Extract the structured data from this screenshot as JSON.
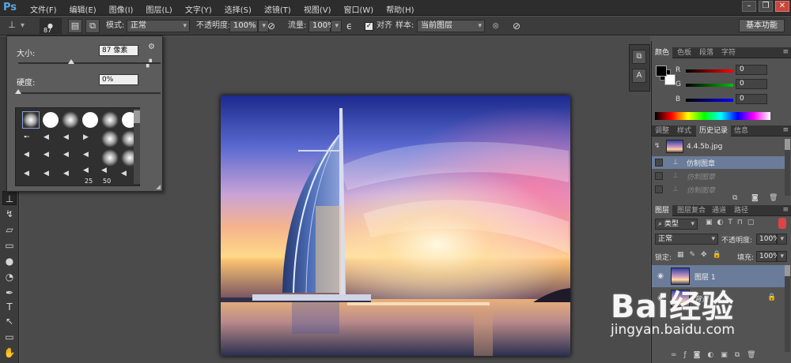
{
  "app": {
    "logo": "Ps"
  },
  "menu": [
    "文件(F)",
    "编辑(E)",
    "图像(I)",
    "图层(L)",
    "文字(Y)",
    "选择(S)",
    "滤镜(T)",
    "视图(V)",
    "窗口(W)",
    "帮助(H)"
  ],
  "options": {
    "brush_size": "87",
    "mode_label": "模式:",
    "mode_value": "正常",
    "opacity_label": "不透明度:",
    "opacity_value": "100%",
    "flow_label": "流量:",
    "flow_value": "100%",
    "aligned_label": "对齐",
    "sample_label": "样本:",
    "sample_value": "当前图层",
    "workspace": "基本功能"
  },
  "brush_popup": {
    "size_label": "大小:",
    "size_value": "87 像素",
    "size_fraction": 0.37,
    "hardness_label": "硬度:",
    "hardness_value": "0%",
    "hardness_fraction": 0.0,
    "preset_numbers": [
      "25",
      "50"
    ]
  },
  "color_panel": {
    "tabs": [
      "颜色",
      "色板",
      "段落",
      "字符"
    ],
    "channels": [
      {
        "label": "R",
        "value": "0",
        "color": "#ff0000"
      },
      {
        "label": "G",
        "value": "0",
        "color": "#00c000"
      },
      {
        "label": "B",
        "value": "0",
        "color": "#0000ff"
      }
    ],
    "foreground": "#000000",
    "background": "#ffffff"
  },
  "history_panel": {
    "tabs": [
      "调整",
      "样式",
      "历史记录",
      "信息"
    ],
    "snapshot": "4.4.5b.jpg",
    "items": [
      {
        "label": "仿制图章",
        "state": "selected"
      },
      {
        "label": "仿制图章",
        "state": "dim"
      },
      {
        "label": "仿制图章",
        "state": "dim"
      }
    ]
  },
  "layers_panel": {
    "tabs": [
      "图层",
      "图层复合",
      "通道",
      "路径"
    ],
    "kind_value": "类型",
    "blend_value": "正常",
    "opacity_label": "不透明度:",
    "opacity_value": "100%",
    "lock_label": "锁定:",
    "fill_label": "填充:",
    "fill_value": "100%",
    "layers": [
      {
        "name": "图层 1",
        "selected": true
      },
      {
        "name": "背景",
        "selected": false
      }
    ]
  },
  "watermark": {
    "logo": "Bai经验",
    "url": "jingyan.baidu.com"
  }
}
